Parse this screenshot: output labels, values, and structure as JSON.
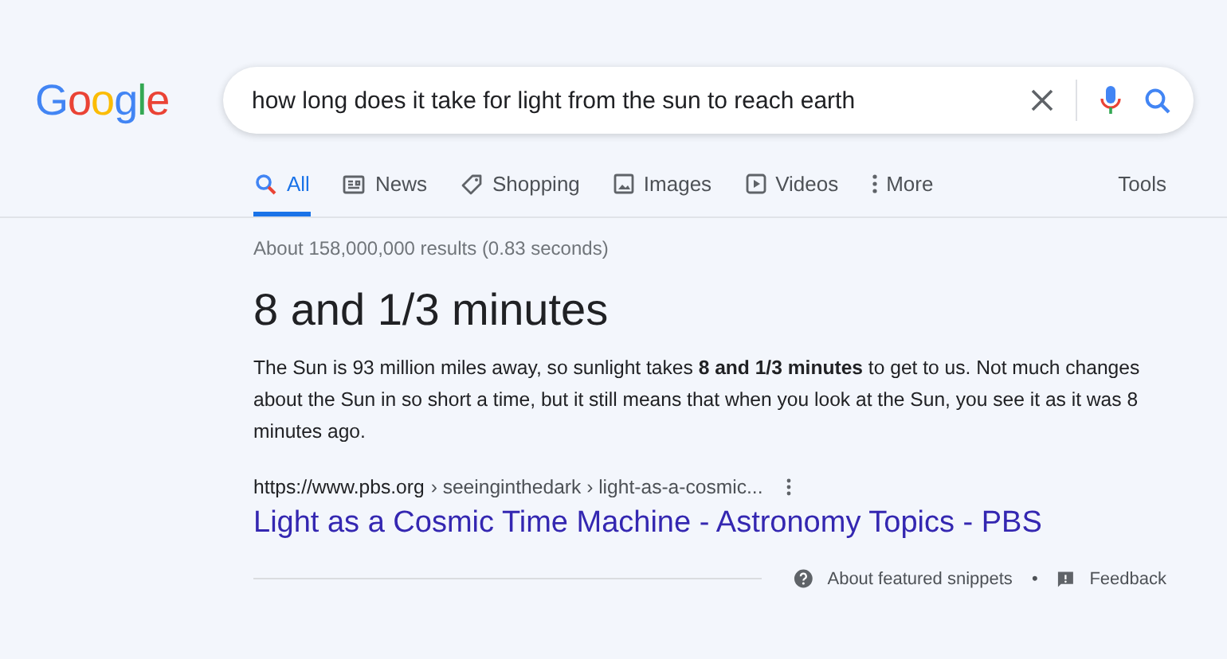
{
  "logo": "Google",
  "search": {
    "value": "how long does it take for light from the sun to reach earth"
  },
  "tabs": [
    {
      "kind": "all",
      "label": "All",
      "selected": true
    },
    {
      "kind": "news",
      "label": "News",
      "selected": false
    },
    {
      "kind": "shopping",
      "label": "Shopping",
      "selected": false
    },
    {
      "kind": "images",
      "label": "Images",
      "selected": false
    },
    {
      "kind": "videos",
      "label": "Videos",
      "selected": false
    },
    {
      "kind": "more",
      "label": "More",
      "selected": false
    }
  ],
  "tools": "Tools",
  "result_stats": "About 158,000,000 results (0.83 seconds)",
  "snippet": {
    "answer": "8 and 1/3 minutes",
    "text": "The Sun is 93 million miles away, so sunlight takes **8 and 1/3 minutes** to get to us. Not much changes about the Sun in so short a time, but it still means that when you look at the Sun, you see it as it was 8 minutes ago.",
    "url_host": "https://www.pbs.org",
    "url_path": "› seeinginthedark › light-as-a-cosmic...",
    "title": "Light as a Cosmic Time Machine - Astronomy Topics - PBS",
    "about": "About featured snippets",
    "separator": "•",
    "feedback": "Feedback"
  }
}
